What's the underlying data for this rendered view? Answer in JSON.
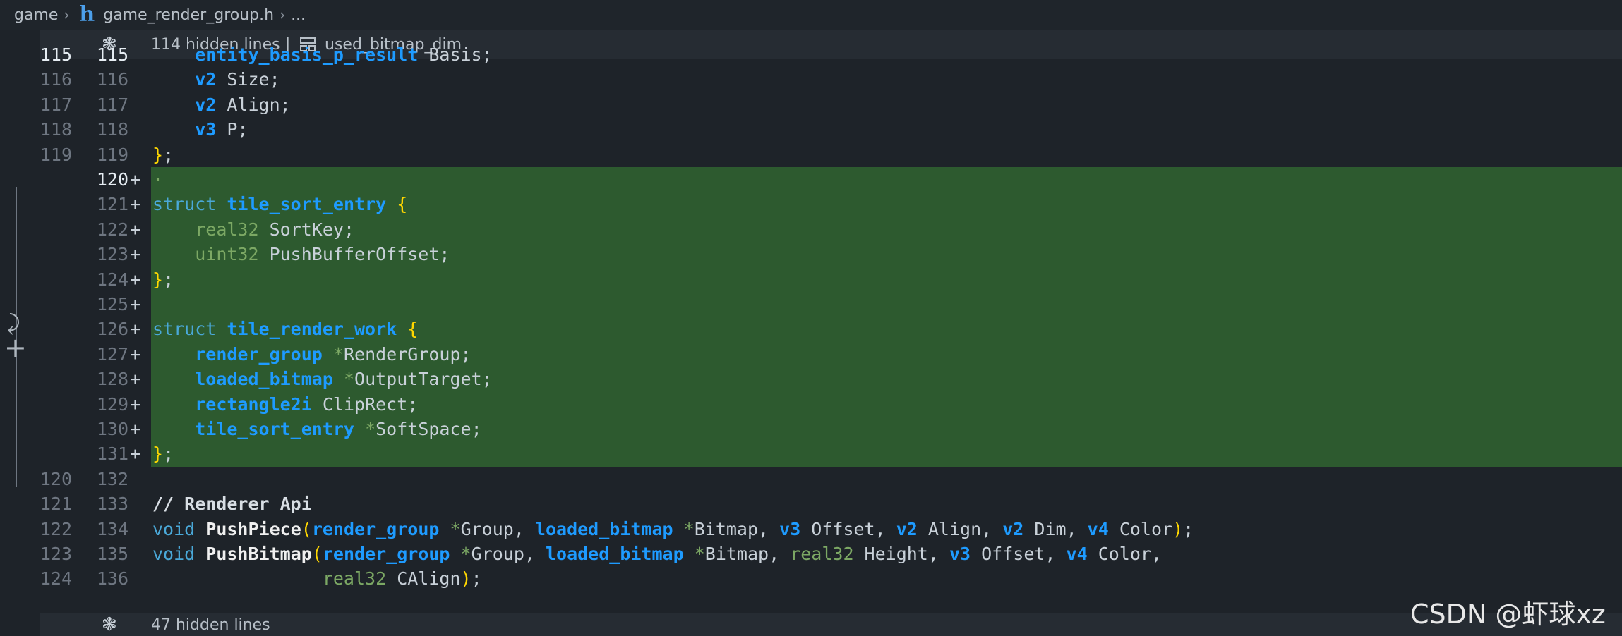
{
  "breadcrumb": {
    "root": "game",
    "file": "game_render_group.h",
    "ellipsis": "..."
  },
  "hidden_top": {
    "text": "114 hidden lines",
    "separator": "|",
    "symbol": "used_bitmap_dim"
  },
  "hidden_bottom": {
    "text": "47 hidden lines"
  },
  "lines": [
    {
      "old": "115",
      "new": "115",
      "added": false,
      "active": true,
      "code": [
        [
          "    ",
          ""
        ],
        [
          "entity_basis_p_result",
          "ty"
        ],
        [
          " Basis;",
          ""
        ]
      ]
    },
    {
      "old": "116",
      "new": "116",
      "added": false,
      "active": false,
      "code": [
        [
          "    ",
          ""
        ],
        [
          "v2",
          "ty"
        ],
        [
          " Size;",
          ""
        ]
      ]
    },
    {
      "old": "117",
      "new": "117",
      "added": false,
      "active": false,
      "code": [
        [
          "    ",
          ""
        ],
        [
          "v2",
          "ty"
        ],
        [
          " Align;",
          ""
        ]
      ]
    },
    {
      "old": "118",
      "new": "118",
      "added": false,
      "active": false,
      "code": [
        [
          "    ",
          ""
        ],
        [
          "v3",
          "ty"
        ],
        [
          " P;",
          ""
        ]
      ]
    },
    {
      "old": "119",
      "new": "119",
      "added": false,
      "active": false,
      "code": [
        [
          "}",
          "br"
        ],
        [
          ";",
          ""
        ]
      ]
    },
    {
      "old": "",
      "new": "120",
      "added": true,
      "active": true,
      "code": [
        [
          "·",
          "sty"
        ]
      ]
    },
    {
      "old": "",
      "new": "121",
      "added": true,
      "active": false,
      "code": [
        [
          "struct",
          "kw"
        ],
        [
          " ",
          ""
        ],
        [
          "tile_sort_entry",
          "ty"
        ],
        [
          " ",
          ""
        ],
        [
          "{",
          "br"
        ]
      ]
    },
    {
      "old": "",
      "new": "122",
      "added": true,
      "active": false,
      "code": [
        [
          "    ",
          ""
        ],
        [
          "real32",
          "sty"
        ],
        [
          " SortKey;",
          ""
        ]
      ]
    },
    {
      "old": "",
      "new": "123",
      "added": true,
      "active": false,
      "code": [
        [
          "    ",
          ""
        ],
        [
          "uint32",
          "sty"
        ],
        [
          " PushBufferOffset;",
          ""
        ]
      ]
    },
    {
      "old": "",
      "new": "124",
      "added": true,
      "active": false,
      "code": [
        [
          "}",
          "br"
        ],
        [
          ";",
          ""
        ]
      ]
    },
    {
      "old": "",
      "new": "125",
      "added": true,
      "active": false,
      "code": []
    },
    {
      "old": "",
      "new": "126",
      "added": true,
      "active": false,
      "code": [
        [
          "struct",
          "kw"
        ],
        [
          " ",
          ""
        ],
        [
          "tile_render_work",
          "ty"
        ],
        [
          " ",
          ""
        ],
        [
          "{",
          "br"
        ]
      ]
    },
    {
      "old": "",
      "new": "127",
      "added": true,
      "active": false,
      "code": [
        [
          "    ",
          ""
        ],
        [
          "render_group",
          "ty"
        ],
        [
          " ",
          ""
        ],
        [
          "*",
          "ptr"
        ],
        [
          "RenderGroup;",
          ""
        ]
      ]
    },
    {
      "old": "",
      "new": "128",
      "added": true,
      "active": false,
      "code": [
        [
          "    ",
          ""
        ],
        [
          "loaded_bitmap",
          "ty"
        ],
        [
          " ",
          ""
        ],
        [
          "*",
          "ptr"
        ],
        [
          "OutputTarget;",
          ""
        ]
      ]
    },
    {
      "old": "",
      "new": "129",
      "added": true,
      "active": false,
      "code": [
        [
          "    ",
          ""
        ],
        [
          "rectangle2i",
          "ty"
        ],
        [
          " ClipRect;",
          ""
        ]
      ]
    },
    {
      "old": "",
      "new": "130",
      "added": true,
      "active": false,
      "code": [
        [
          "    ",
          ""
        ],
        [
          "tile_sort_entry",
          "ty"
        ],
        [
          " ",
          ""
        ],
        [
          "*",
          "ptr"
        ],
        [
          "SoftSpace;",
          ""
        ]
      ]
    },
    {
      "old": "",
      "new": "131",
      "added": true,
      "active": false,
      "code": [
        [
          "}",
          "br"
        ],
        [
          ";",
          ""
        ]
      ]
    },
    {
      "old": "120",
      "new": "132",
      "added": false,
      "active": false,
      "code": []
    },
    {
      "old": "121",
      "new": "133",
      "added": false,
      "active": false,
      "code": [
        [
          "// Renderer Api",
          "com"
        ]
      ]
    },
    {
      "old": "122",
      "new": "134",
      "added": false,
      "active": false,
      "code": [
        [
          "void",
          "kw"
        ],
        [
          " ",
          ""
        ],
        [
          "PushPiece",
          "fn"
        ],
        [
          "(",
          "br"
        ],
        [
          "render_group",
          "ty"
        ],
        [
          " ",
          ""
        ],
        [
          "*",
          "ptr"
        ],
        [
          "Group, ",
          ""
        ],
        [
          "loaded_bitmap",
          "ty"
        ],
        [
          " ",
          ""
        ],
        [
          "*",
          "ptr"
        ],
        [
          "Bitmap, ",
          ""
        ],
        [
          "v3",
          "ty"
        ],
        [
          " Offset, ",
          ""
        ],
        [
          "v2",
          "ty"
        ],
        [
          " Align, ",
          ""
        ],
        [
          "v2",
          "ty"
        ],
        [
          " Dim, ",
          ""
        ],
        [
          "v4",
          "ty"
        ],
        [
          " Color",
          ""
        ],
        [
          ")",
          "br"
        ],
        [
          ";",
          ""
        ]
      ]
    },
    {
      "old": "123",
      "new": "135",
      "added": false,
      "active": false,
      "code": [
        [
          "void",
          "kw"
        ],
        [
          " ",
          ""
        ],
        [
          "PushBitmap",
          "fn"
        ],
        [
          "(",
          "br"
        ],
        [
          "render_group",
          "ty"
        ],
        [
          " ",
          ""
        ],
        [
          "*",
          "ptr"
        ],
        [
          "Group, ",
          ""
        ],
        [
          "loaded_bitmap",
          "ty"
        ],
        [
          " ",
          ""
        ],
        [
          "*",
          "ptr"
        ],
        [
          "Bitmap, ",
          ""
        ],
        [
          "real32",
          "sty"
        ],
        [
          " Height, ",
          ""
        ],
        [
          "v3",
          "ty"
        ],
        [
          " Offset, ",
          ""
        ],
        [
          "v4",
          "ty"
        ],
        [
          " Color,",
          ""
        ]
      ]
    },
    {
      "old": "124",
      "new": "136",
      "added": false,
      "active": false,
      "code": [
        [
          "                ",
          ""
        ],
        [
          "real32",
          "sty"
        ],
        [
          " CAlign",
          ""
        ],
        [
          ")",
          "br"
        ],
        [
          ";",
          ""
        ]
      ]
    }
  ],
  "watermark": "CSDN @虾球xz",
  "colors": {
    "added_bg": "#2d5a2f",
    "type_blue": "#1e9bff",
    "keyword": "#4aa8d8",
    "bracket": "#ffd700",
    "editor_bg": "#1e2329"
  }
}
